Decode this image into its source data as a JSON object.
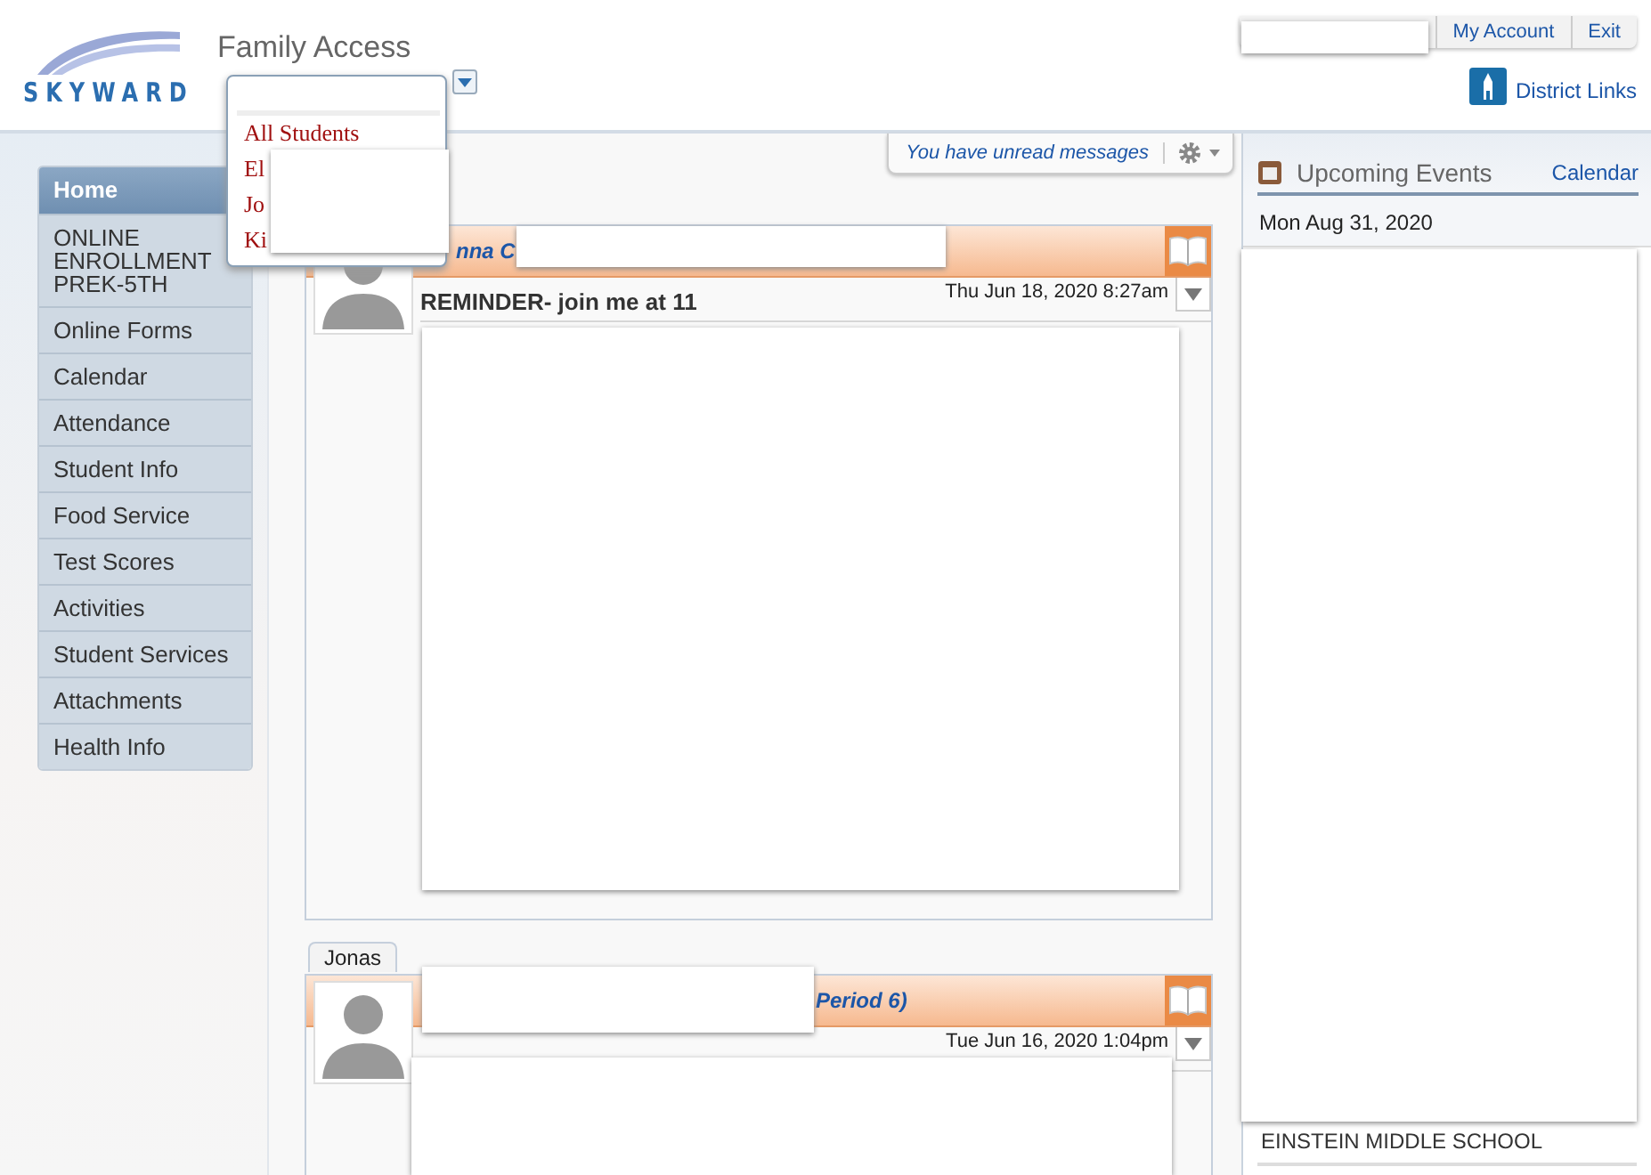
{
  "header": {
    "logo_text": "SKYWARD",
    "app_title": "Family Access",
    "student_dropdown": {
      "items": [
        {
          "label": "All Students"
        },
        {
          "label": "El"
        },
        {
          "label": "Jo"
        },
        {
          "label": "Ki"
        }
      ]
    },
    "top_links": [
      "My Account",
      "Exit"
    ],
    "district_links": "District Links"
  },
  "sidebar": {
    "items": [
      {
        "label": "Home",
        "selected": true
      },
      {
        "label": "ONLINE ENROLLMENT PREK-5TH",
        "selected": false
      },
      {
        "label": "Online Forms",
        "selected": false
      },
      {
        "label": "Calendar",
        "selected": false
      },
      {
        "label": "Attendance",
        "selected": false
      },
      {
        "label": "Student Info",
        "selected": false
      },
      {
        "label": "Food Service",
        "selected": false
      },
      {
        "label": "Test Scores",
        "selected": false
      },
      {
        "label": "Activities",
        "selected": false
      },
      {
        "label": "Student Services",
        "selected": false
      },
      {
        "label": "Attachments",
        "selected": false
      },
      {
        "label": "Health Info",
        "selected": false
      }
    ]
  },
  "toolbar": {
    "message": "You have unread messages"
  },
  "messages": [
    {
      "sender": "nna C",
      "subject": "REMINDER- join me at 11",
      "date": "Thu Jun 18, 2020 8:27am"
    },
    {
      "tab": "Jonas",
      "sender": "Period 6)",
      "date": "Tue Jun 16, 2020 1:04pm"
    }
  ],
  "events": {
    "title": "Upcoming Events",
    "link": "Calendar",
    "date": "Mon Aug 31, 2020",
    "school": "EINSTEIN MIDDLE SCHOOL"
  }
}
